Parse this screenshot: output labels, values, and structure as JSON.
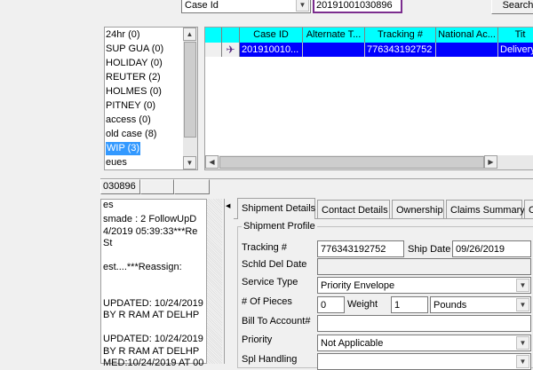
{
  "search": {
    "field": "Case Id",
    "value": "20191001030896",
    "button": "Search"
  },
  "queues": {
    "items": [
      "24hr (0)",
      "SUP GUA  (0)",
      "HOLIDAY (0)",
      "REUTER (2)",
      "HOLMES  (0)",
      "PITNEY  (0)",
      "access (0)",
      "old case (8)",
      "WIP (3)"
    ],
    "selected_index": 8,
    "footer": "eues"
  },
  "grid": {
    "columns": [
      "",
      "Case ID",
      "Alternate T...",
      "Tracking #",
      "National Ac...",
      "Tit"
    ],
    "row": {
      "case_id": "201910010...",
      "alternate": "",
      "tracking": "776343192752",
      "national": "",
      "title": "Delivery"
    }
  },
  "open_case_tab": "030896",
  "notes": {
    "header": "es",
    "lines": [
      "smade : 2      FollowUpD",
      "4/2019 05:39:33***Re",
      "St",
      "",
      "est....***Reassign:",
      "",
      "",
      "UPDATED:  10/24/2019",
      "BY R RAM       AT DELHP",
      "",
      "UPDATED:  10/24/2019",
      "BY R RAM       AT DELHP",
      "MED:10/24/2019 AT 00"
    ]
  },
  "detail_tabs": [
    "Shipment Details",
    "Contact Details",
    "Ownership",
    "Claims Summary",
    "C"
  ],
  "shipment": {
    "group_title": "Shipment Profile",
    "tracking_label": "Tracking #",
    "tracking_value": "776343192752",
    "ship_date_label": "Ship Date",
    "ship_date_value": "09/26/2019",
    "schld_label": "Schld Del Date",
    "schld_value": "",
    "service_label": "Service Type",
    "service_value": "Priority Envelope",
    "pieces_label": "# Of Pieces",
    "pieces_value": "0",
    "weight_label": "Weight",
    "weight_value": "1",
    "weight_unit": "Pounds",
    "bill_label": "Bill To Account#",
    "bill_value": "",
    "priority_label": "Priority",
    "priority_value": "Not Applicable",
    "spl_label": "Spl Handling",
    "spl_value": ""
  }
}
